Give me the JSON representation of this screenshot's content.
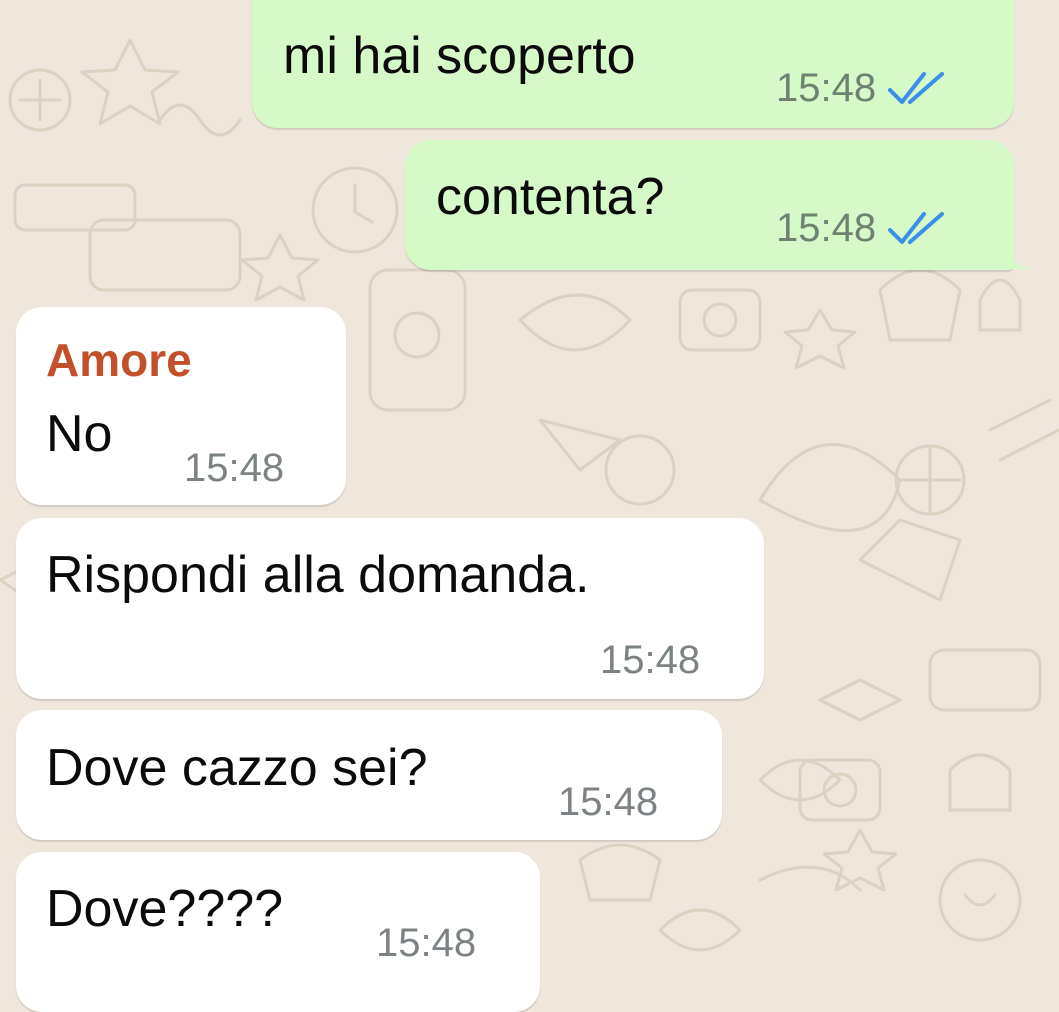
{
  "chat": {
    "messages": [
      {
        "direction": "outgoing",
        "text": "mi hai scoperto",
        "time": "15:48",
        "status": "read-double-check"
      },
      {
        "direction": "outgoing",
        "text": "contenta?",
        "time": "15:48",
        "status": "read-double-check"
      },
      {
        "direction": "incoming",
        "sender": "Amore",
        "text": "No",
        "time": "15:48"
      },
      {
        "direction": "incoming",
        "text": "Rispondi alla domanda.",
        "time": "15:48"
      },
      {
        "direction": "incoming",
        "text": "Dove cazzo sei?",
        "time": "15:48"
      },
      {
        "direction": "incoming",
        "text": "Dove????",
        "time": "15:48"
      }
    ]
  },
  "colors": {
    "background": "#efe7dc",
    "outgoing_bubble": "#d6fac7",
    "incoming_bubble": "#ffffff",
    "sender_name": "#c2502a",
    "read_check": "#3b8eea",
    "timestamp": "#7d8385"
  },
  "icons": {
    "read_status": "double-check-icon"
  }
}
